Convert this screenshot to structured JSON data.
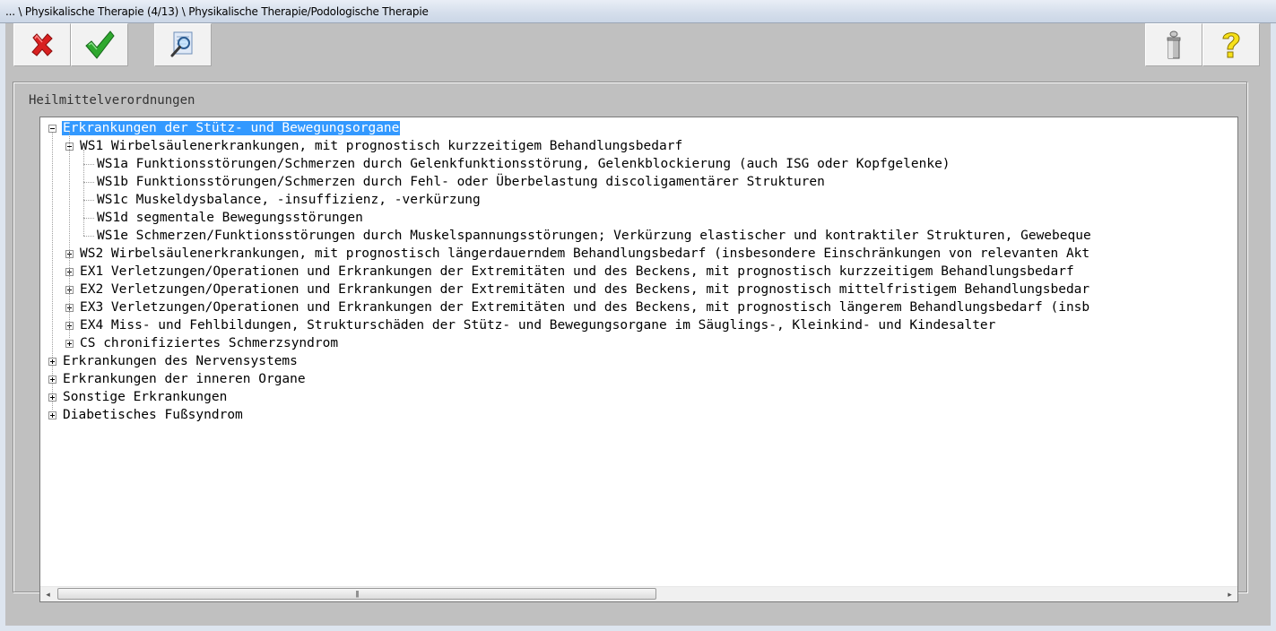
{
  "window": {
    "title": "... \\ Physikalische Therapie (4/13) \\ Physikalische Therapie/Podologische Therapie"
  },
  "toolbar": {
    "cancel_icon": "red-x-icon",
    "confirm_icon": "green-checkmark-icon",
    "search_icon": "document-magnifier-icon",
    "info_icon": "info-pillar-icon",
    "help_icon": "yellow-question-icon"
  },
  "group": {
    "label": "Heilmittelverordnungen"
  },
  "tree": {
    "items": [
      {
        "label": "Erkrankungen der Stütz- und Bewegungsorgane",
        "level": 0,
        "expander": "minus",
        "selected": true
      },
      {
        "label": "WS1 Wirbelsäulenerkrankungen, mit prognostisch kurzzeitigem Behandlungsbedarf",
        "level": 1,
        "expander": "minus"
      },
      {
        "label": "WS1a Funktionsstörungen/Schmerzen durch Gelenkfunktionsstörung, Gelenkblockierung (auch ISG oder Kopfgelenke)",
        "level": 2,
        "expander": "none"
      },
      {
        "label": "WS1b Funktionsstörungen/Schmerzen durch Fehl- oder Überbelastung discoligamentärer Strukturen",
        "level": 2,
        "expander": "none"
      },
      {
        "label": "WS1c Muskeldysbalance, -insuffizienz, -verkürzung",
        "level": 2,
        "expander": "none"
      },
      {
        "label": "WS1d segmentale Bewegungsstörungen",
        "level": 2,
        "expander": "none"
      },
      {
        "label": "WS1e Schmerzen/Funktionsstörungen durch Muskelspannungsstörungen; Verkürzung elastischer und kontraktiler Strukturen, Gewebeque",
        "level": 2,
        "expander": "none"
      },
      {
        "label": "WS2 Wirbelsäulenerkrankungen, mit prognostisch längerdauerndem Behandlungsbedarf (insbesondere Einschränkungen von relevanten Akt",
        "level": 1,
        "expander": "plus"
      },
      {
        "label": "EX1 Verletzungen/Operationen und Erkrankungen der Extremitäten und des Beckens, mit prognostisch kurzzeitigem Behandlungsbedarf",
        "level": 1,
        "expander": "plus"
      },
      {
        "label": "EX2 Verletzungen/Operationen und Erkrankungen der Extremitäten und des Beckens, mit prognostisch mittelfristigem Behandlungsbedar",
        "level": 1,
        "expander": "plus"
      },
      {
        "label": "EX3 Verletzungen/Operationen und Erkrankungen der Extremitäten und des Beckens, mit prognostisch längerem Behandlungsbedarf (insb",
        "level": 1,
        "expander": "plus"
      },
      {
        "label": "EX4 Miss- und Fehlbildungen, Strukturschäden der Stütz- und Bewegungsorgane im Säuglings-, Kleinkind- und Kindesalter",
        "level": 1,
        "expander": "plus"
      },
      {
        "label": "CS chronifiziertes Schmerzsyndrom",
        "level": 1,
        "expander": "plus"
      },
      {
        "label": "Erkrankungen des Nervensystems",
        "level": 0,
        "expander": "plus"
      },
      {
        "label": "Erkrankungen der inneren Organe",
        "level": 0,
        "expander": "plus"
      },
      {
        "label": "Sonstige Erkrankungen",
        "level": 0,
        "expander": "plus"
      },
      {
        "label": "Diabetisches Fußsyndrom",
        "level": 0,
        "expander": "plus"
      }
    ]
  },
  "scrollbar": {
    "left_arrow": "◂",
    "right_arrow": "▸",
    "grip": "|||"
  }
}
